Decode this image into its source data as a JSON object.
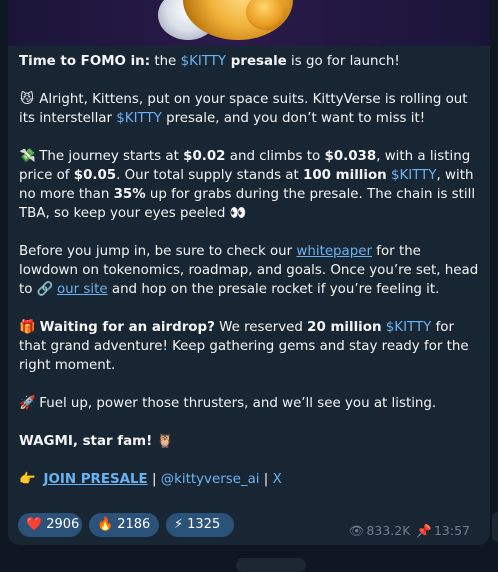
{
  "message": {
    "p1": {
      "lead": "Time to FOMO in:",
      "mid": " the ",
      "ticker": "$KITTY",
      "bold2": " presale",
      "tail": " is go for launch!"
    },
    "p2": {
      "emoji": "😼",
      "a": " Alright, Kittens, put on your space suits. KittyVerse is rolling out its interstellar ",
      "ticker": "$KITTY",
      "b": " presale, and you don’t want to miss it!"
    },
    "p3": {
      "emoji": "💸",
      "a": " The journey starts at ",
      "price1": "$0.02",
      "b": " and climbs to ",
      "price2": "$0.038",
      "c": ", with a listing price of ",
      "price3": "$0.05",
      "d": ". Our total supply stands at ",
      "supply": "100 million",
      "e": " ",
      "ticker": "$KITTY",
      "f": ", with no more than ",
      "pct": "35%",
      "g": " up for grabs during the presale. The chain is still TBA, so keep your eyes peeled ",
      "emoji2": "👀"
    },
    "p4": {
      "a": "Before you jump in, be sure to check our ",
      "whitepaper": "whitepaper",
      "b": " for the lowdown on tokenomics, roadmap, and goals. Once you’re set, head to ",
      "link_emoji": "🔗",
      "site": "our site",
      "c": " and hop on the presale rocket if you’re feeling it."
    },
    "p5": {
      "emoji": "🎁",
      "lead": " Waiting for an airdrop?",
      "a": " We reserved ",
      "amount": "20 million",
      "b": " ",
      "ticker": "$KITTY",
      "c": " for that grand adventure! Keep gathering gems and stay ready for the right moment."
    },
    "p6": {
      "emoji": "🚀",
      "a": " Fuel up, power those thrusters, and we’ll see you at listing."
    },
    "p7": {
      "bold": "WAGMI, star fam!",
      "emoji": "🦉"
    },
    "p8": {
      "emoji": "👉",
      "join": "JOIN PRESALE",
      "sep1": " | ",
      "handle": "@kittyverse_ai",
      "sep2": " | ",
      "x": "X"
    }
  },
  "reactions": [
    {
      "emoji": "❤️",
      "count": "2906"
    },
    {
      "emoji": "🔥",
      "count": "2186"
    },
    {
      "emoji": "⚡",
      "count": "1325"
    }
  ],
  "meta": {
    "views": "833.2K",
    "time": "13:57"
  },
  "colors": {
    "bubble": "#182533",
    "link": "#6ab3f3",
    "reaction": "#2b5278",
    "meta": "#6d7f8f"
  }
}
